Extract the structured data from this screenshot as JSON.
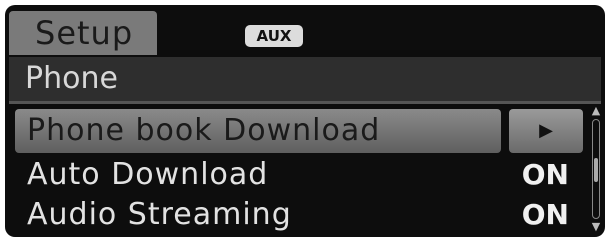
{
  "header": {
    "tab_label": "Setup",
    "source_badge": "AUX"
  },
  "section": {
    "title": "Phone"
  },
  "menu": {
    "items": [
      {
        "label": "Phone book Download",
        "value": "",
        "icon": "chevron-right-icon",
        "selected": true
      },
      {
        "label": "Auto Download",
        "value": "ON",
        "selected": false
      },
      {
        "label": "Audio Streaming",
        "value": "ON",
        "selected": false
      }
    ]
  },
  "colors": {
    "background": "#0d0d0d",
    "highlight": "#7a7a7a",
    "text": "#e2e2e2"
  }
}
